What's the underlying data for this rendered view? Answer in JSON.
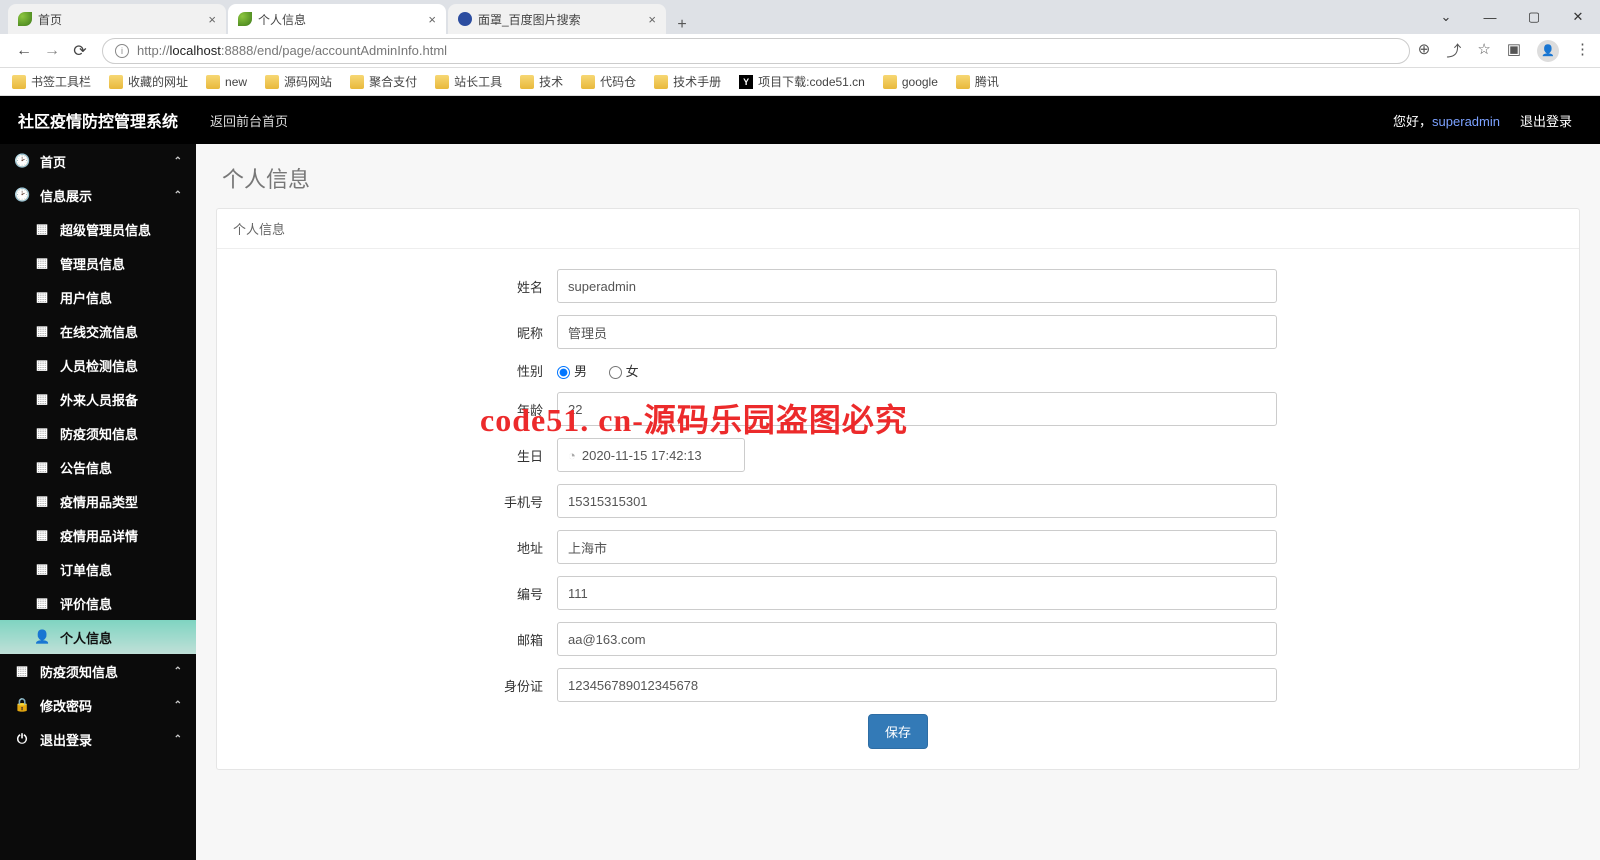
{
  "browser": {
    "tabs": [
      {
        "title": "首页",
        "active": false,
        "favicon": "leaf"
      },
      {
        "title": "个人信息",
        "active": true,
        "favicon": "leaf"
      },
      {
        "title": "面罩_百度图片搜索",
        "active": false,
        "favicon": "paw"
      }
    ],
    "url_prefix": "http://",
    "url_host": "localhost",
    "url_rest": ":8888/end/page/accountAdminInfo.html",
    "bookmarks": [
      "书签工具栏",
      "收藏的网址",
      "new",
      "源码网站",
      "聚合支付",
      "站长工具",
      "技术",
      "代码仓",
      "技术手册",
      "项目下载:code51.cn",
      "google",
      "腾讯"
    ]
  },
  "app": {
    "brand": "社区疫情防控管理系统",
    "back_link": "返回前台首页",
    "greeting": "您好，",
    "username": "superadmin",
    "logout": "退出登录"
  },
  "sidebar": {
    "home": "首页",
    "info": "信息展示",
    "subs": [
      "超级管理员信息",
      "管理员信息",
      "用户信息",
      "在线交流信息",
      "人员检测信息",
      "外来人员报备",
      "防疫须知信息",
      "公告信息",
      "疫情用品类型",
      "疫情用品详情",
      "订单信息",
      "评价信息",
      "个人信息"
    ],
    "active_sub": "个人信息",
    "menu3": "防疫须知信息",
    "menu4": "修改密码",
    "menu5": "退出登录"
  },
  "page": {
    "title": "个人信息",
    "card_title": "个人信息",
    "labels": {
      "name": "姓名",
      "nick": "昵称",
      "gender": "性别",
      "age": "年龄",
      "birthday": "生日",
      "phone": "手机号",
      "addr": "地址",
      "code": "编号",
      "email": "邮箱",
      "idcard": "身份证"
    },
    "gender_opts": {
      "male": "男",
      "female": "女"
    },
    "values": {
      "name": "superadmin",
      "nick": "管理员",
      "gender": "男",
      "age": "22",
      "birthday": "2020-11-15 17:42:13",
      "phone": "15315315301",
      "addr": "上海市",
      "code": "111",
      "email": "aa@163.com",
      "idcard": "123456789012345678"
    },
    "save": "保存"
  },
  "watermark": "code51. cn-源码乐园盗图必究"
}
